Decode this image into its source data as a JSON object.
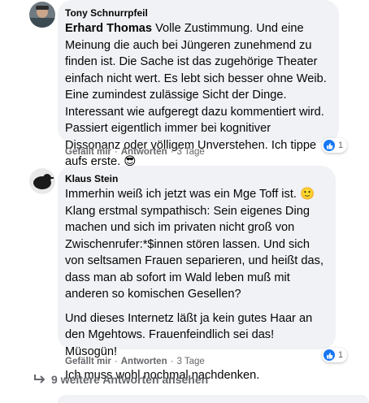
{
  "comments": [
    {
      "author": "Tony Schnurrpfeil",
      "mention": "Erhard Thomas",
      "text": " Volle Zustimmung. Und eine Meinung die auch bei Jüngeren zunehmend zu finden ist. Die Sache ist das zugehörige Theater einfach nicht wert. Es lebt sich besser ohne Weib. Eine zumindest zulässige Sicht der Dinge. Interessant wie aufgeregt dazu kommentiert wird. Passiert eigentlich immer bei kognitiver Dissonanz oder völligem Unverstehen. Ich tippe aufs erste.",
      "emoji": "😎",
      "like_label": "Gefällt mir",
      "reply_label": "Antworten",
      "time": "3 Tage",
      "reaction_count": "1"
    },
    {
      "author": "Klaus Stein",
      "paragraphs": [
        "Immerhin weiß ich jetzt was ein Mge Toff ist. 🙂 Klang erstmal sympathisch: Sein eigenes Ding machen und sich im privaten nicht groß von Zwischenrufer:*$innen stören lassen. Und sich von seltsamen Frauen separieren, und heißt das, dass man ab sofort im Wald leben muß mit anderen so komischen Gesellen?",
        "Und dieses Internetz läßt ja kein gutes Haar an den Mgehtows. Frauenfeindlich sei das! Müsogün!",
        "Ich muss wohl nochmal nachdenken."
      ],
      "like_label": "Gefällt mir",
      "reply_label": "Antworten",
      "time": "3 Tage",
      "reaction_count": "1"
    }
  ],
  "more_replies": "9 weitere Antworten ansehen",
  "colors": {
    "bubble": "#f0f2f5",
    "meta": "#65676b",
    "like_blue": "#1877f2"
  }
}
